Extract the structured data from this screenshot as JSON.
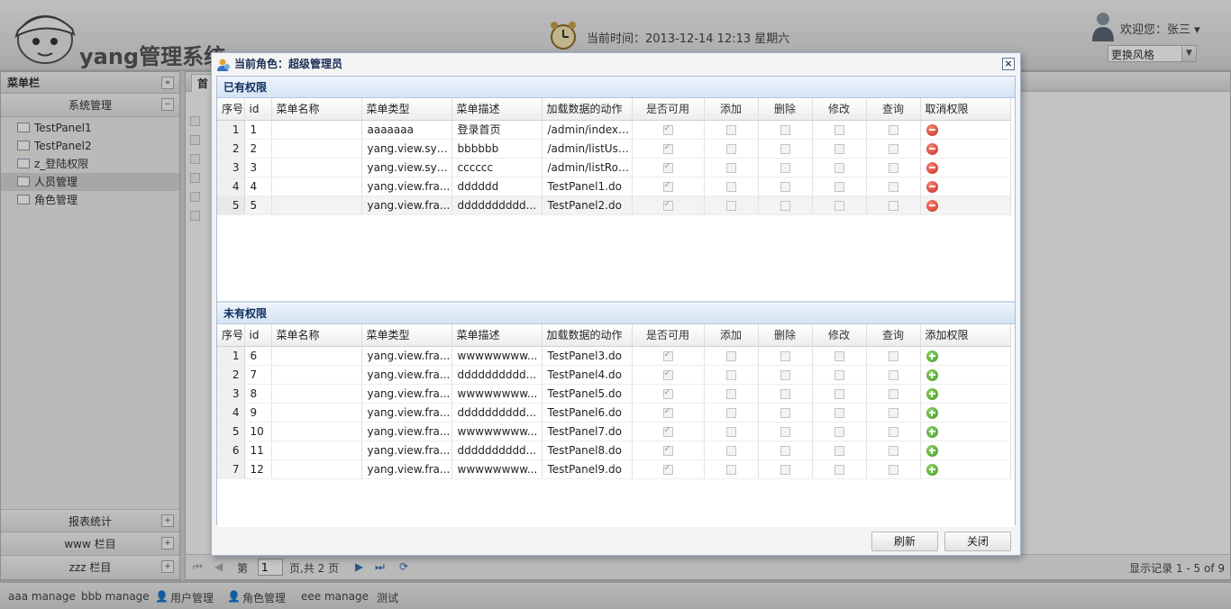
{
  "header": {
    "system_title": "yang管理系统",
    "time_label": "当前时间：2013-12-14 12:13 星期六",
    "welcome": "欢迎您：张三 ▾",
    "style_select": "更换风格"
  },
  "west": {
    "title": "菜单栏",
    "collapse_icon": "«",
    "panels": [
      {
        "title": "系统管理",
        "icon": "minus",
        "items": [
          "TestPanel1",
          "TestPanel2",
          "z_登陆权限",
          "人员管理",
          "角色管理"
        ],
        "selected": 3
      },
      {
        "title": "报表统计",
        "icon": "plus"
      },
      {
        "title": "www 栏目",
        "icon": "plus"
      },
      {
        "title": "zzz 栏目",
        "icon": "plus"
      }
    ]
  },
  "center": {
    "tab_label": "首",
    "pager": {
      "page_prefix": "第",
      "page_value": "1",
      "page_suffix": "页,共 2 页",
      "records": "显示记录 1 - 5 of 9"
    }
  },
  "bottom_bar": [
    "aaa manage",
    "bbb manage",
    "用户管理",
    "角色管理",
    "eee manage",
    "测试"
  ],
  "dialog": {
    "title": "当前角色：超级管理员",
    "close": "×",
    "owned": {
      "title": "已有权限",
      "columns": [
        "序号",
        "id",
        "菜单名称",
        "菜单类型",
        "菜单描述",
        "加载数据的动作",
        "是否可用",
        "添加",
        "删除",
        "修改",
        "查询",
        "取消权限"
      ],
      "rows": [
        [
          "1",
          "1",
          "",
          "aaaaaaa",
          "登录首页",
          "/admin/index...."
        ],
        [
          "2",
          "2",
          "",
          "yang.view.sys...",
          "bbbbbb",
          "/admin/listUser*"
        ],
        [
          "3",
          "3",
          "",
          "yang.view.sys...",
          "cccccc",
          "/admin/listRol..."
        ],
        [
          "4",
          "4",
          "",
          "yang.view.fra...",
          "dddddd",
          "TestPanel1.do"
        ],
        [
          "5",
          "5",
          "",
          "yang.view.fra...",
          "dddddddddd...",
          "TestPanel2.do"
        ]
      ]
    },
    "missing": {
      "title": "未有权限",
      "columns": [
        "序号",
        "id",
        "菜单名称",
        "菜单类型",
        "菜单描述",
        "加载数据的动作",
        "是否可用",
        "添加",
        "删除",
        "修改",
        "查询",
        "添加权限"
      ],
      "rows": [
        [
          "1",
          "6",
          "",
          "yang.view.fra...",
          "wwwwwwww...",
          "TestPanel3.do"
        ],
        [
          "2",
          "7",
          "",
          "yang.view.fra...",
          "dddddddddd...",
          "TestPanel4.do"
        ],
        [
          "3",
          "8",
          "",
          "yang.view.fra...",
          "wwwwwwww...",
          "TestPanel5.do"
        ],
        [
          "4",
          "9",
          "",
          "yang.view.fra...",
          "dddddddddd...",
          "TestPanel6.do"
        ],
        [
          "5",
          "10",
          "",
          "yang.view.fra...",
          "wwwwwwww...",
          "TestPanel7.do"
        ],
        [
          "6",
          "11",
          "",
          "yang.view.fra...",
          "dddddddddd...",
          "TestPanel8.do"
        ],
        [
          "7",
          "12",
          "",
          "yang.view.fra...",
          "wwwwwwww...",
          "TestPanel9.do"
        ]
      ]
    },
    "buttons": {
      "refresh": "刷新",
      "close": "关闭"
    }
  },
  "colors": {
    "accent": "#0e2d5f",
    "remove": "#c9261a",
    "add": "#3f9a1e"
  }
}
